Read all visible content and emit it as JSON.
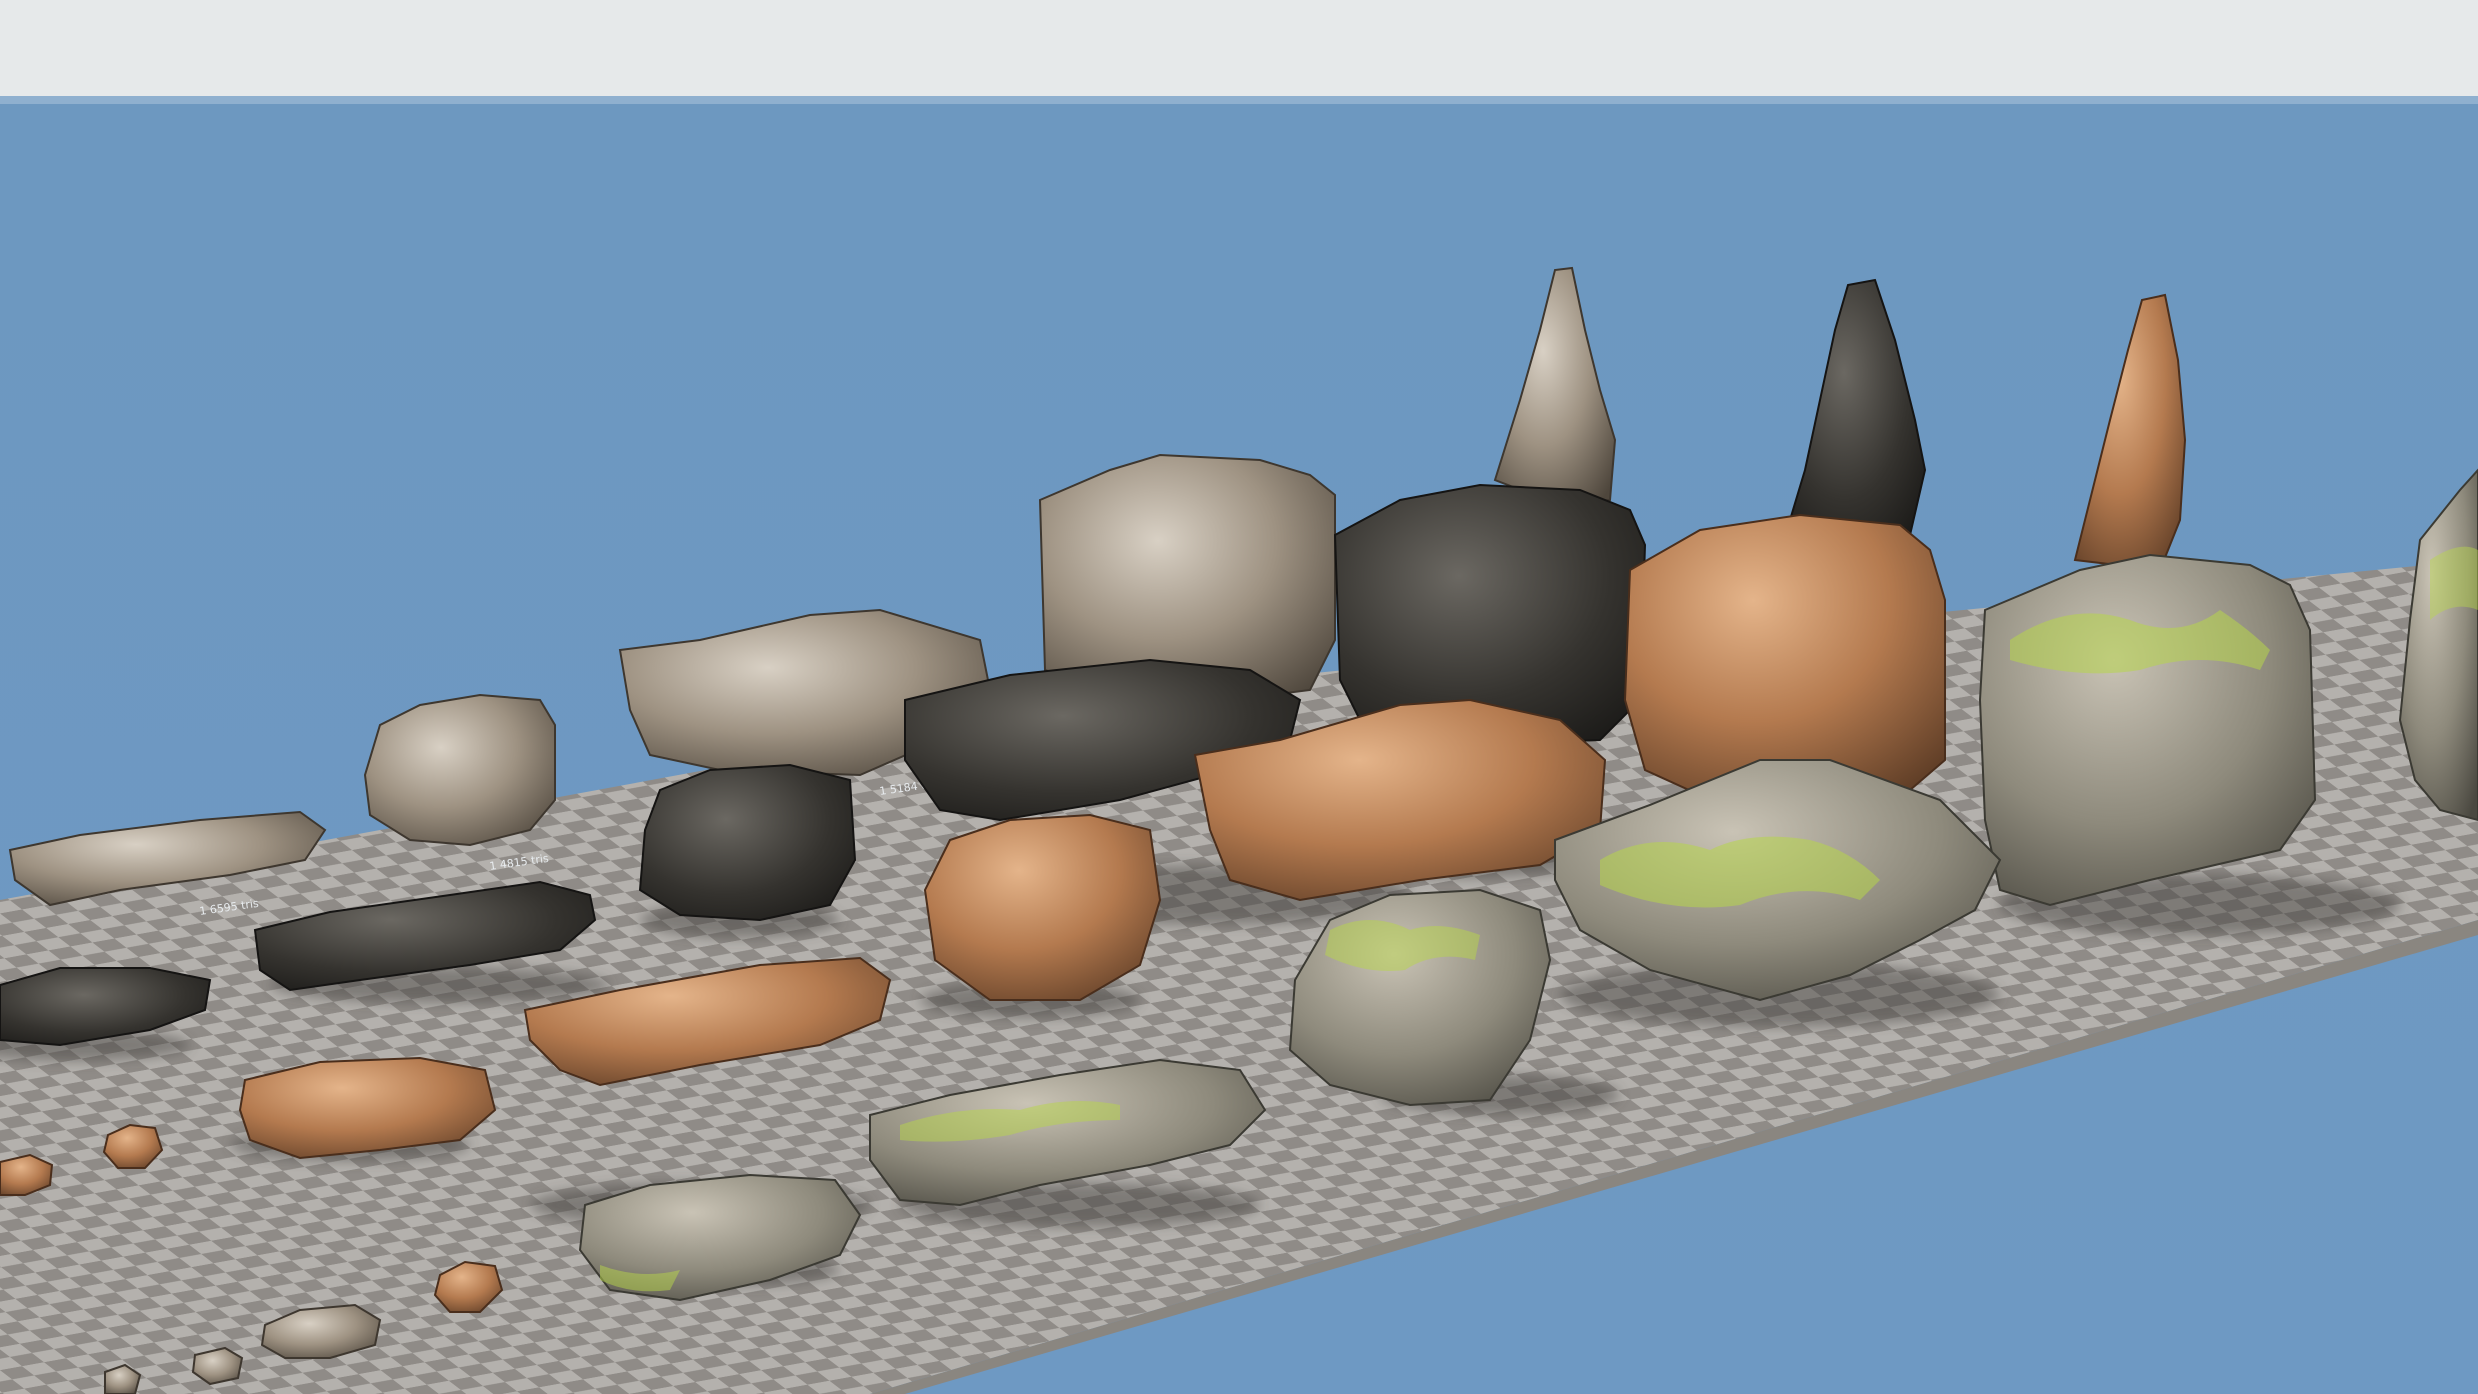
{
  "scene": {
    "colors": {
      "sky_band": "#e6e9ea",
      "background_blue": "#6f9ac2",
      "checker_light": "#b4b1ad",
      "checker_dark": "#8f8b87",
      "platform_edge": "#8a8680",
      "moss": "#b7d64a"
    },
    "labels": [
      "1 6595 tris",
      "1 4815 tris",
      "1 5184 tris"
    ]
  }
}
